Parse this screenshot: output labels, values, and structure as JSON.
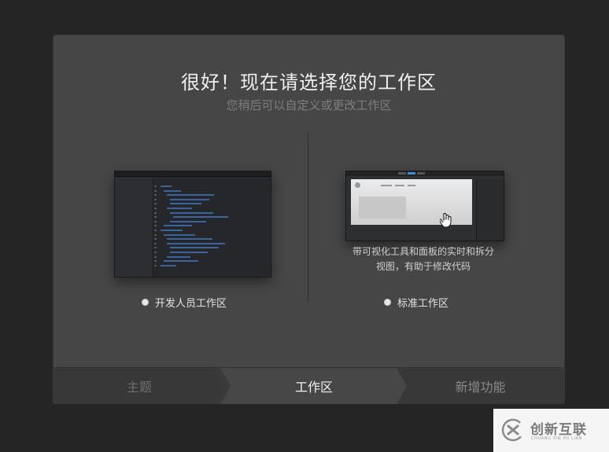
{
  "dialog": {
    "title": "很好！现在请选择您的工作区",
    "subtitle": "您稍后可以自定义或更改工作区"
  },
  "workspaces": {
    "developer": {
      "label": "开发人员工作区",
      "selected": false
    },
    "standard": {
      "label": "标准工作区",
      "selected": false,
      "description_line1": "带可视化工具和面板的实时和拆分",
      "description_line2": "视图，有助于修改代码"
    }
  },
  "steps": [
    {
      "label": "主题",
      "state": "done"
    },
    {
      "label": "工作区",
      "state": "current"
    },
    {
      "label": "新增功能",
      "state": "upcoming"
    }
  ],
  "watermark": {
    "text": "创新互联",
    "sub": "CHUANG XIN HU LIAN"
  },
  "colors": {
    "accent": "#3a8fd8",
    "background": "#252525",
    "dialog": "#464646"
  }
}
